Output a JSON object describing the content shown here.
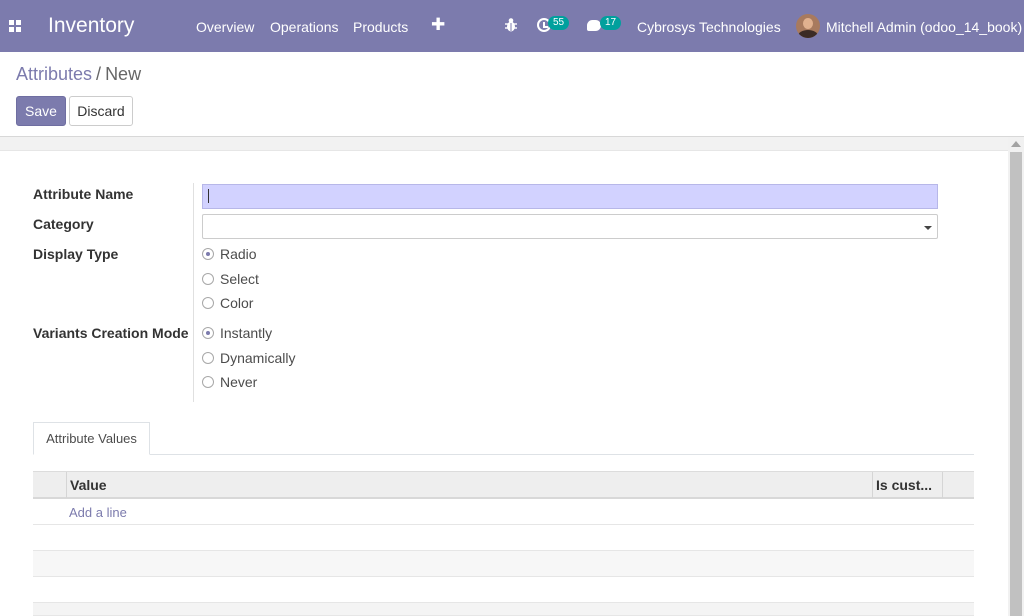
{
  "navbar": {
    "app_name": "Inventory",
    "menu": [
      "Overview",
      "Operations",
      "Products"
    ],
    "plus_glyph": "✚",
    "activity_count": "55",
    "message_count": "17",
    "company": "Cybrosys Technologies",
    "user": "Mitchell Admin (odoo_14_book)",
    "icons": [
      "apps-grid-icon",
      "bug-icon",
      "activity-clock-icon",
      "chat-icon",
      "avatar"
    ]
  },
  "breadcrumb": {
    "parent": "Attributes",
    "separator": "/",
    "current": "New"
  },
  "buttons": {
    "save": "Save",
    "discard": "Discard"
  },
  "form": {
    "attribute_name_label": "Attribute Name",
    "attribute_name_value": "",
    "category_label": "Category",
    "category_value": "",
    "display_type_label": "Display Type",
    "display_type_options": [
      "Radio",
      "Select",
      "Color"
    ],
    "display_type_selected": "Radio",
    "variants_label": "Variants Creation Mode",
    "variants_options": [
      "Instantly",
      "Dynamically",
      "Never"
    ],
    "variants_selected": "Instantly"
  },
  "notebook": {
    "tab_label": "Attribute Values",
    "columns": [
      "Value",
      "Is cust..."
    ],
    "add_line": "Add a line"
  },
  "colors": {
    "brand": "#7c7bad",
    "badge": "#00a09d",
    "required_input": "#d2d2ff"
  }
}
